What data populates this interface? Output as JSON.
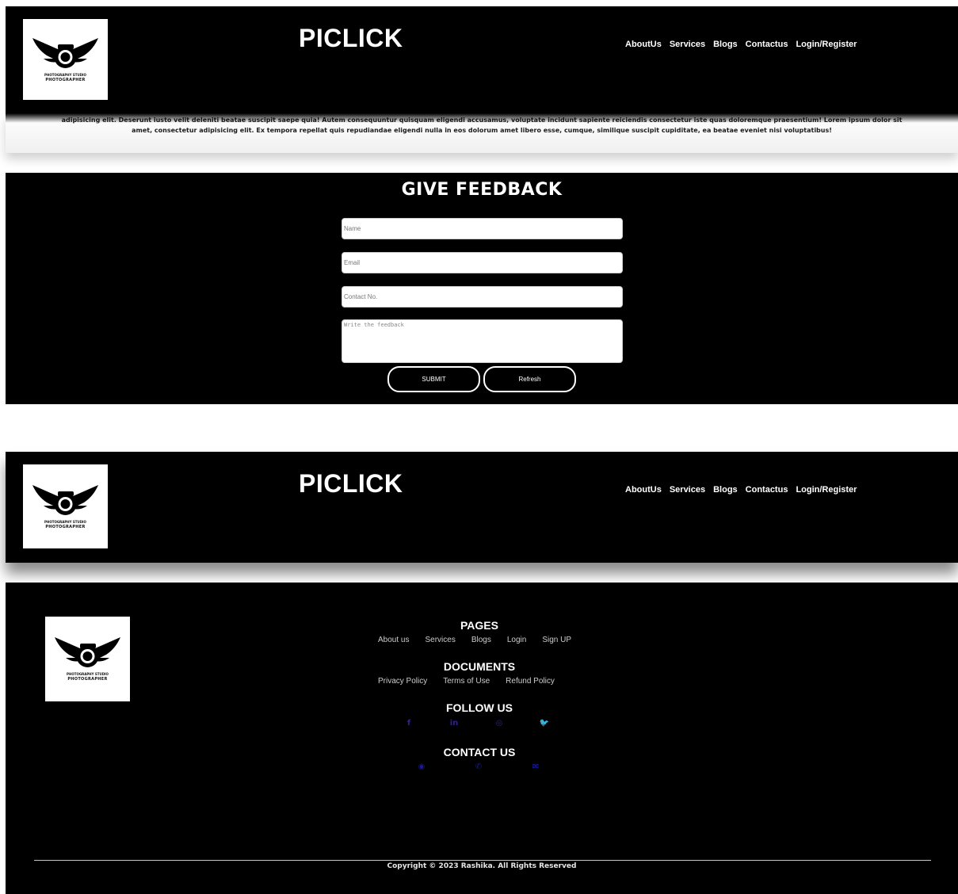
{
  "brand": {
    "title": "PICLICK",
    "logo_small_text": "PHOTOGRAPHY STUDIO",
    "logo_text": "PHOTOGRAPHER"
  },
  "nav": [
    "AboutUs",
    "Services",
    "Blogs",
    "Contactus",
    "Login/Register"
  ],
  "lorem": {
    "line1": "adipisicing elit. Deserunt iusto velit deleniti beatae suscipit saepe quia! Autem consequuntur quisquam eligendi accusamus, voluptate incidunt sapiente reiciendis consectetur iste quas doloremque praesentium! Lorem ipsum dolor sit",
    "line2": "amet, consectetur adipisicing elit. Ex tempora repellat quis repudiandae eligendi nulla in eos dolorum amet libero esse, cumque, similique suscipit cupiditate, ea beatae eveniet nisi voluptatibus!"
  },
  "feedback": {
    "title": "GIVE FEEDBACK",
    "name_placeholder": "Name",
    "email_placeholder": "Email",
    "contact_placeholder": "Contact No.",
    "feedback_placeholder": "Write the feedback",
    "submit_label": "SUBMIT",
    "refresh_label": "Refresh"
  },
  "footer": {
    "pages_heading": "PAGES",
    "pages": [
      "About us",
      "Services",
      "Blogs",
      "Login",
      "Sign UP"
    ],
    "documents_heading": "DOCUMENTS",
    "documents": [
      "Privacy Policy",
      "Terms of Use",
      "Refund Policy"
    ],
    "follow_heading": "FOLLOW US",
    "social_icons": [
      {
        "name": "facebook-icon",
        "glyph": "f",
        "color": "#3a1e8c"
      },
      {
        "name": "linkedin-icon",
        "glyph": "in",
        "color": "#3a1e8c"
      },
      {
        "name": "instagram-icon",
        "glyph": "◎",
        "color": "#3a1e8c"
      },
      {
        "name": "twitter-icon",
        "glyph": "🐦",
        "color": "#3a1e8c"
      }
    ],
    "contact_heading": "CONTACT US",
    "contact_icons": [
      {
        "name": "location-icon",
        "glyph": "◉",
        "color": "#1a1a8c"
      },
      {
        "name": "phone-icon",
        "glyph": "✆",
        "color": "#1a1a8c"
      },
      {
        "name": "email-icon",
        "glyph": "✉",
        "color": "#2020c8"
      }
    ],
    "copyright": "Copyright © 2023 Rashika. All Rights Reserved"
  }
}
